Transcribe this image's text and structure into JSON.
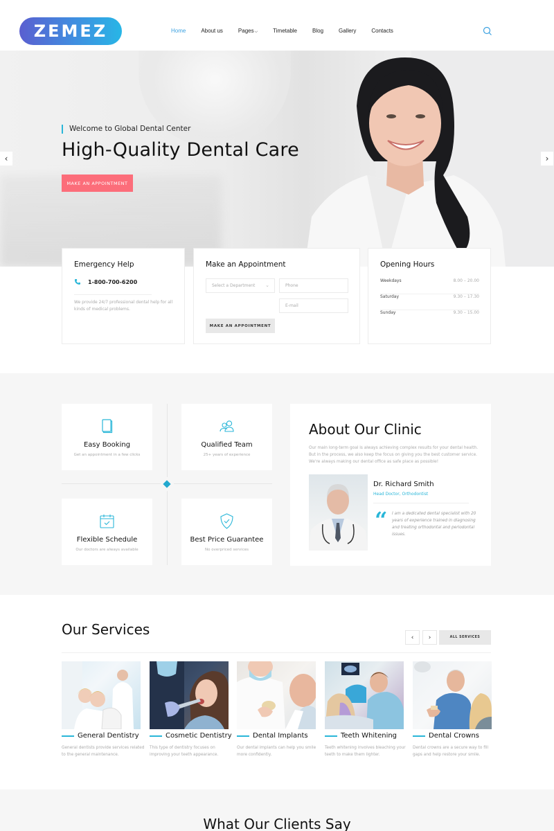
{
  "header": {
    "logo": "ZEMEZ",
    "nav": [
      {
        "label": "Home",
        "active": true
      },
      {
        "label": "About us"
      },
      {
        "label": "Pages",
        "has_dropdown": true
      },
      {
        "label": "Timetable"
      },
      {
        "label": "Blog"
      },
      {
        "label": "Gallery"
      },
      {
        "label": "Contacts"
      }
    ],
    "search_icon": "search-icon"
  },
  "hero": {
    "kicker": "Welcome to Global Dental Center",
    "title": "High-Quality Dental Care",
    "cta": "MAKE AN APPOINTMENT",
    "prev_icon": "‹",
    "next_icon": "›"
  },
  "emergency": {
    "title": "Emergency Help",
    "phone": "1-800-700-6200",
    "text": "We provide 24/7 professional dental help for all kinds of medical problems."
  },
  "appointment": {
    "title": "Make an Appointment",
    "department_placeholder": "Select a Department",
    "phone_placeholder": "Phone",
    "email_placeholder": "E-mail",
    "button": "MAKE AN APPOINTMENT"
  },
  "hours": {
    "title": "Opening Hours",
    "rows": [
      {
        "day": "Weekdays",
        "time": "8.00 – 20.00"
      },
      {
        "day": "Saturday",
        "time": "9.30 – 17.30"
      },
      {
        "day": "Sunday",
        "time": "9.30 – 15.00"
      }
    ]
  },
  "features": [
    {
      "icon": "book-icon",
      "title": "Easy Booking",
      "text": "Get an appointment in a few clicks"
    },
    {
      "icon": "team-icon",
      "title": "Qualified Team",
      "text": "25+ years of experience"
    },
    {
      "icon": "calendar-check-icon",
      "title": "Flexible Schedule",
      "text": "Our doctors are always available"
    },
    {
      "icon": "shield-check-icon",
      "title": "Best Price Guarantee",
      "text": "No overpriced services"
    }
  ],
  "about": {
    "title": "About Our Clinic",
    "text": "Our main long-term goal is always achieving complex results for your dental health. But in the process, we also keep the focus on giving you the best customer service. We're always making our dental office as safe place as possible!",
    "doctor_name": "Dr. Richard Smith",
    "doctor_role": "Head Doctor, Orthodontist",
    "quote": "I am a dedicated dental specialist with 20 years of experience trained in diagnosing and treating orthodontal and periodontal issues."
  },
  "services": {
    "title": "Our Services",
    "all_button": "ALL SERVICES",
    "prev_icon": "‹",
    "next_icon": "›",
    "items": [
      {
        "title": "General Dentistry",
        "text": "General dentists provide services related to the general maintenance."
      },
      {
        "title": "Cosmetic Dentistry",
        "text": "This type of dentistry focuses on improving your teeth appearance."
      },
      {
        "title": "Dental Implants",
        "text": "Our dental implants can help you smile more confidently."
      },
      {
        "title": "Teeth Whitening",
        "text": "Teeth whitening involves bleaching your teeth to make them lighter."
      },
      {
        "title": "Dental Crowns",
        "text": "Dental crowns are a secure way to fill gaps and help restore your smile."
      }
    ]
  },
  "testimonials": {
    "title": "What Our Clients Say"
  },
  "colors": {
    "accent": "#29b6d8",
    "cta": "#fc6d7a",
    "nav_active": "#3aa0e0"
  }
}
